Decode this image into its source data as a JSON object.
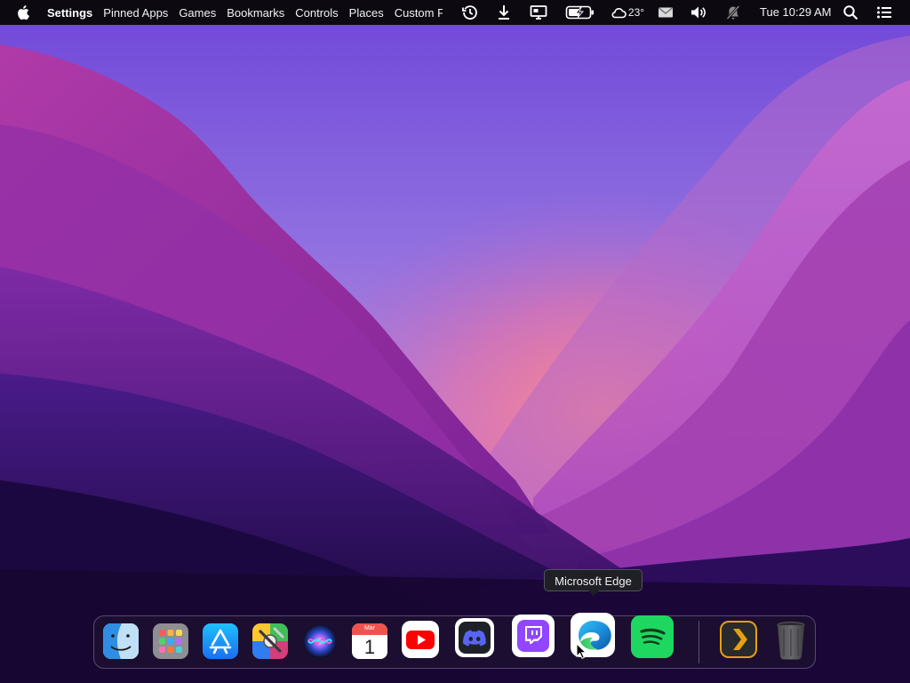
{
  "menubar": {
    "items": [
      "Settings",
      "Pinned Apps",
      "Games",
      "Bookmarks",
      "Controls",
      "Places",
      "Custom Folder"
    ],
    "status_icons": [
      "history-icon",
      "download-icon",
      "display-icon",
      "battery-charging-icon",
      "cloud-icon",
      "mail-icon",
      "volume-icon",
      "notifications-off-icon"
    ],
    "temperature": "23°",
    "clock": "Tue 10:29 AM",
    "right_icons": [
      "search-icon",
      "control-center-icon"
    ]
  },
  "dock": {
    "apps": [
      {
        "name": "Finder",
        "icon": "finder-icon"
      },
      {
        "name": "Launchpad",
        "icon": "launchpad-icon"
      },
      {
        "name": "App Store",
        "icon": "app-store-icon"
      },
      {
        "name": "Color Picker",
        "icon": "color-picker-icon"
      },
      {
        "name": "Siri",
        "icon": "siri-icon"
      },
      {
        "name": "Calendar",
        "icon": "calendar-icon",
        "month": "Mar",
        "day": "1"
      },
      {
        "name": "YouTube",
        "icon": "youtube-icon"
      },
      {
        "name": "Discord",
        "icon": "discord-icon"
      },
      {
        "name": "Twitch",
        "icon": "twitch-icon"
      },
      {
        "name": "Microsoft Edge",
        "icon": "edge-icon"
      },
      {
        "name": "Spotify",
        "icon": "spotify-icon"
      },
      {
        "name": "Plex",
        "icon": "plex-icon"
      },
      {
        "name": "Trash",
        "icon": "trash-icon"
      }
    ]
  },
  "tooltip": {
    "label": "Microsoft Edge"
  },
  "colors": {
    "menubar": "#0c0a10",
    "accent": "#8a2be2",
    "wallpaper_sky": "#7d5be0",
    "wallpaper_glow": "#f07090",
    "wallpaper_dark": "#1a0838"
  }
}
